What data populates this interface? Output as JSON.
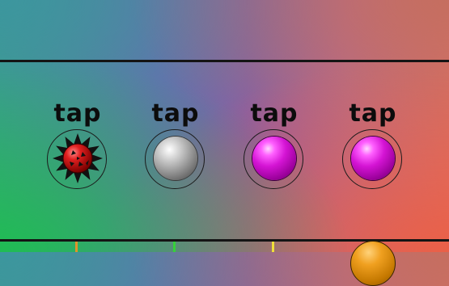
{
  "game": {
    "slots": [
      {
        "label": "tap",
        "ball": "red-spiky-virus-ball"
      },
      {
        "label": "tap",
        "ball": "silver-ball"
      },
      {
        "label": "tap",
        "ball": "magenta-ball"
      },
      {
        "label": "tap",
        "ball": "magenta-ball"
      }
    ],
    "pegs": [
      {
        "color": "#e0932a"
      },
      {
        "color": "#36d13a"
      },
      {
        "color": "#f0e03a"
      }
    ],
    "bottom_ball": "orange-ball"
  },
  "colors": {
    "line": "#141414",
    "silver": "#a8a8a8",
    "magenta": "#d414d4",
    "red": "#d81818",
    "orange": "#f0a020"
  }
}
